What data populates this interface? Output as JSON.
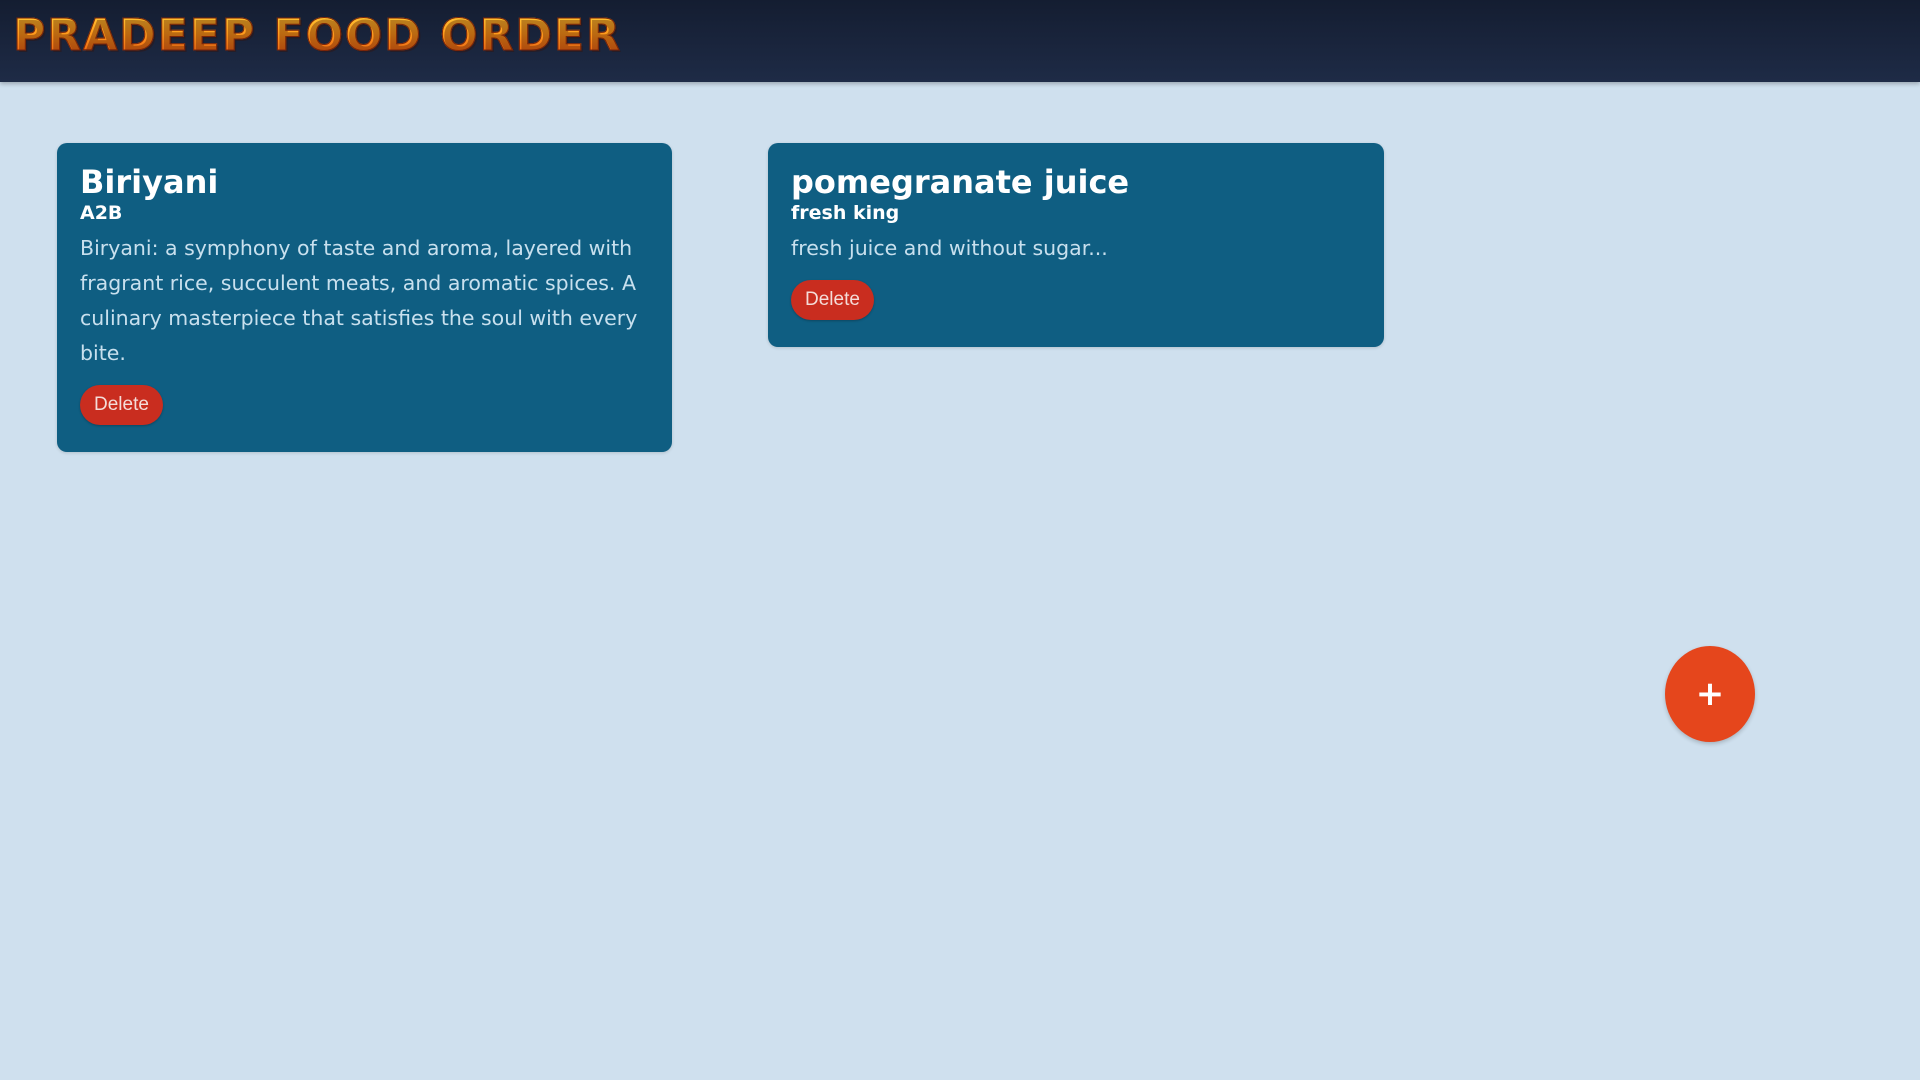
{
  "app": {
    "title": "PRADEEP FOOD ORDER"
  },
  "cards": [
    {
      "name": "Biriyani",
      "restaurant": "A2B",
      "description": "Biryani: a symphony of taste and aroma, layered with fragrant rice, succulent meats, and aromatic spices. A culinary masterpiece that satisfies the soul with every bite.",
      "delete_label": "Delete"
    },
    {
      "name": "pomegranate juice",
      "restaurant": "fresh king",
      "description": "fresh juice and without sugar...",
      "delete_label": "Delete"
    }
  ],
  "fab": {
    "label": "+",
    "icon": "plus-icon"
  },
  "colors": {
    "background": "#cfe0ee",
    "header": "#1a253c",
    "card": "#0f5e82",
    "delete_button": "#c92d1f",
    "fab": "#e5461c",
    "brand_gradient": [
      "#ffd33a",
      "#ff9b1c",
      "#e44b10"
    ]
  }
}
